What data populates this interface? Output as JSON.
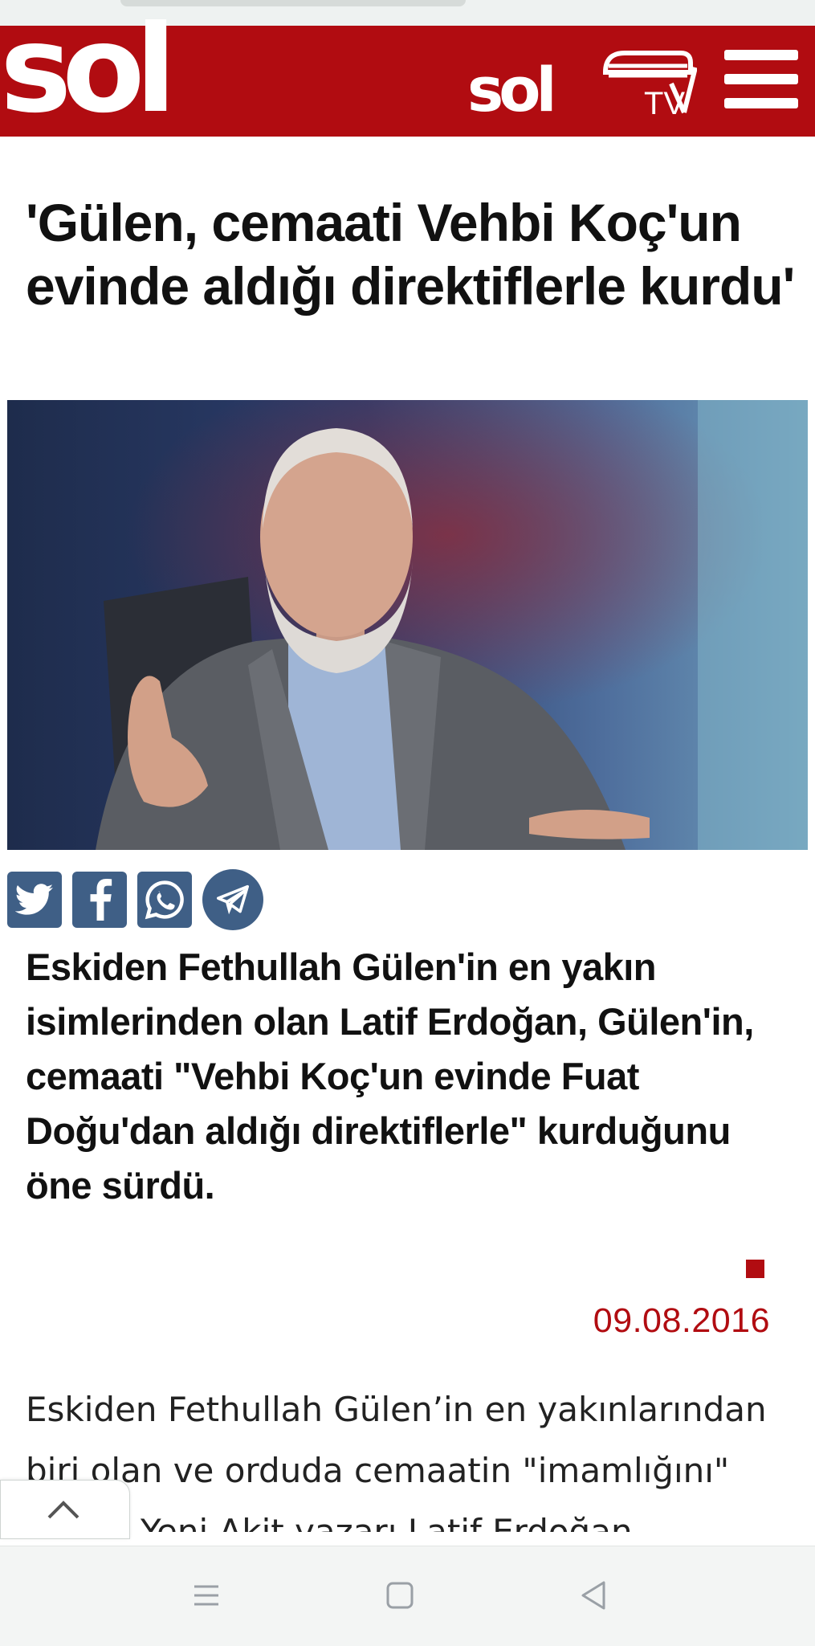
{
  "site": {
    "logo_text": "sol",
    "tv_logo_text": "sol",
    "tv_logo_suffix": "TV"
  },
  "article": {
    "headline": "'Gülen, cemaati Vehbi Koç'un evinde aldığı direktiflerle kurdu'",
    "lead": "Eskiden Fethullah Gülen'in en yakın isimlerinden olan Latif Erdoğan, Gülen'in, cemaati \"Vehbi Koç'un evinde Fuat Doğu'dan aldığı direktiflerle\" kurduğunu öne sürdü.",
    "date": "09.08.2016",
    "body_lines": [
      "Eskiden Fethullah Gülen’in en yakınlarından",
      "biri olan ve orduda cemaatin \"imamlığını\"",
      "yapan Yeni Akit yazarı Latif Erdoğan,"
    ]
  },
  "share": {
    "icons": [
      "twitter-icon",
      "facebook-icon",
      "whatsapp-icon",
      "telegram-icon"
    ]
  },
  "colors": {
    "brand_red": "#b10c11",
    "share_blue": "#3f5f86"
  }
}
